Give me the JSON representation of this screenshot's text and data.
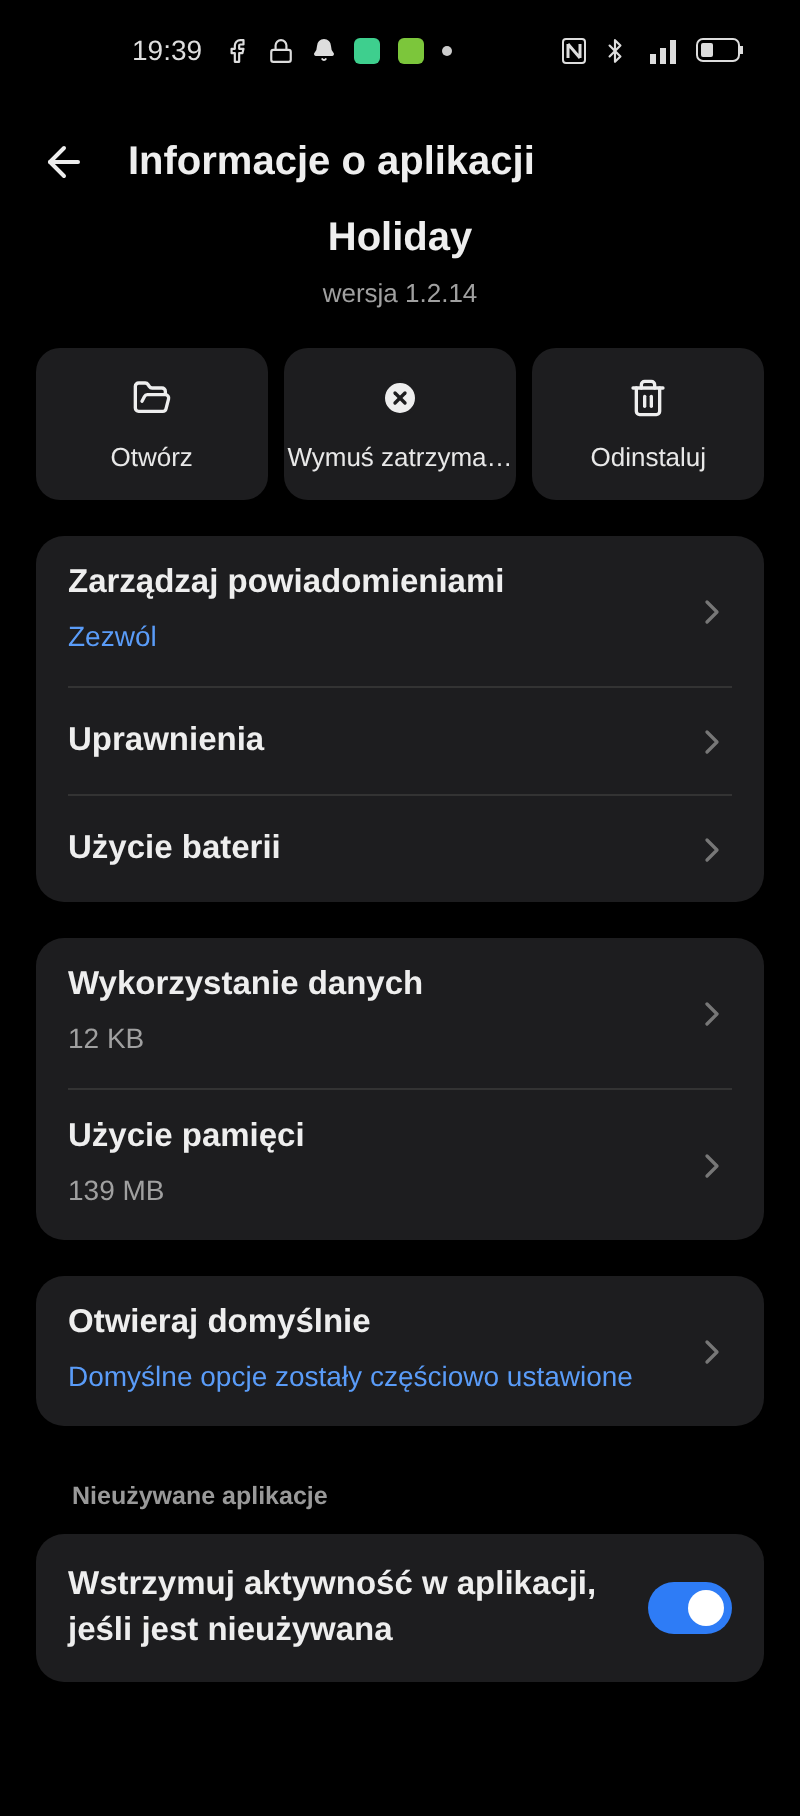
{
  "status_bar": {
    "time": "19:39"
  },
  "header": {
    "title": "Informacje o aplikacji"
  },
  "app": {
    "name": "Holiday",
    "version": "wersja 1.2.14"
  },
  "actions": [
    {
      "kind": "open",
      "label": "Otwórz"
    },
    {
      "kind": "stop",
      "label": "Wymuś zatrzyma…"
    },
    {
      "kind": "uninstall",
      "label": "Odinstaluj"
    }
  ],
  "cards": [
    {
      "rows": [
        {
          "title": "Zarządzaj powiadomieniami",
          "subtitle": "Zezwól",
          "color": "#5a9cf8"
        },
        {
          "title": "Uprawnienia"
        },
        {
          "title": "Użycie baterii"
        }
      ]
    },
    {
      "rows": [
        {
          "title": "Wykorzystanie danych",
          "subtitle": "12 KB",
          "color": "#a0a0a0"
        },
        {
          "title": "Użycie pamięci",
          "subtitle": "139 MB",
          "color": "#a0a0a0"
        }
      ]
    },
    {
      "rows": [
        {
          "title": "Otwieraj domyślnie",
          "subtitle": "Domyślne opcje zostały częściowo ustawione",
          "color": "#5a9cf8"
        }
      ]
    }
  ],
  "unused": {
    "heading": "Nieużywane aplikacje",
    "toggle": {
      "label": "Wstrzymuj aktywność w aplikacji, jeśli jest nieużywana",
      "on": true
    }
  }
}
